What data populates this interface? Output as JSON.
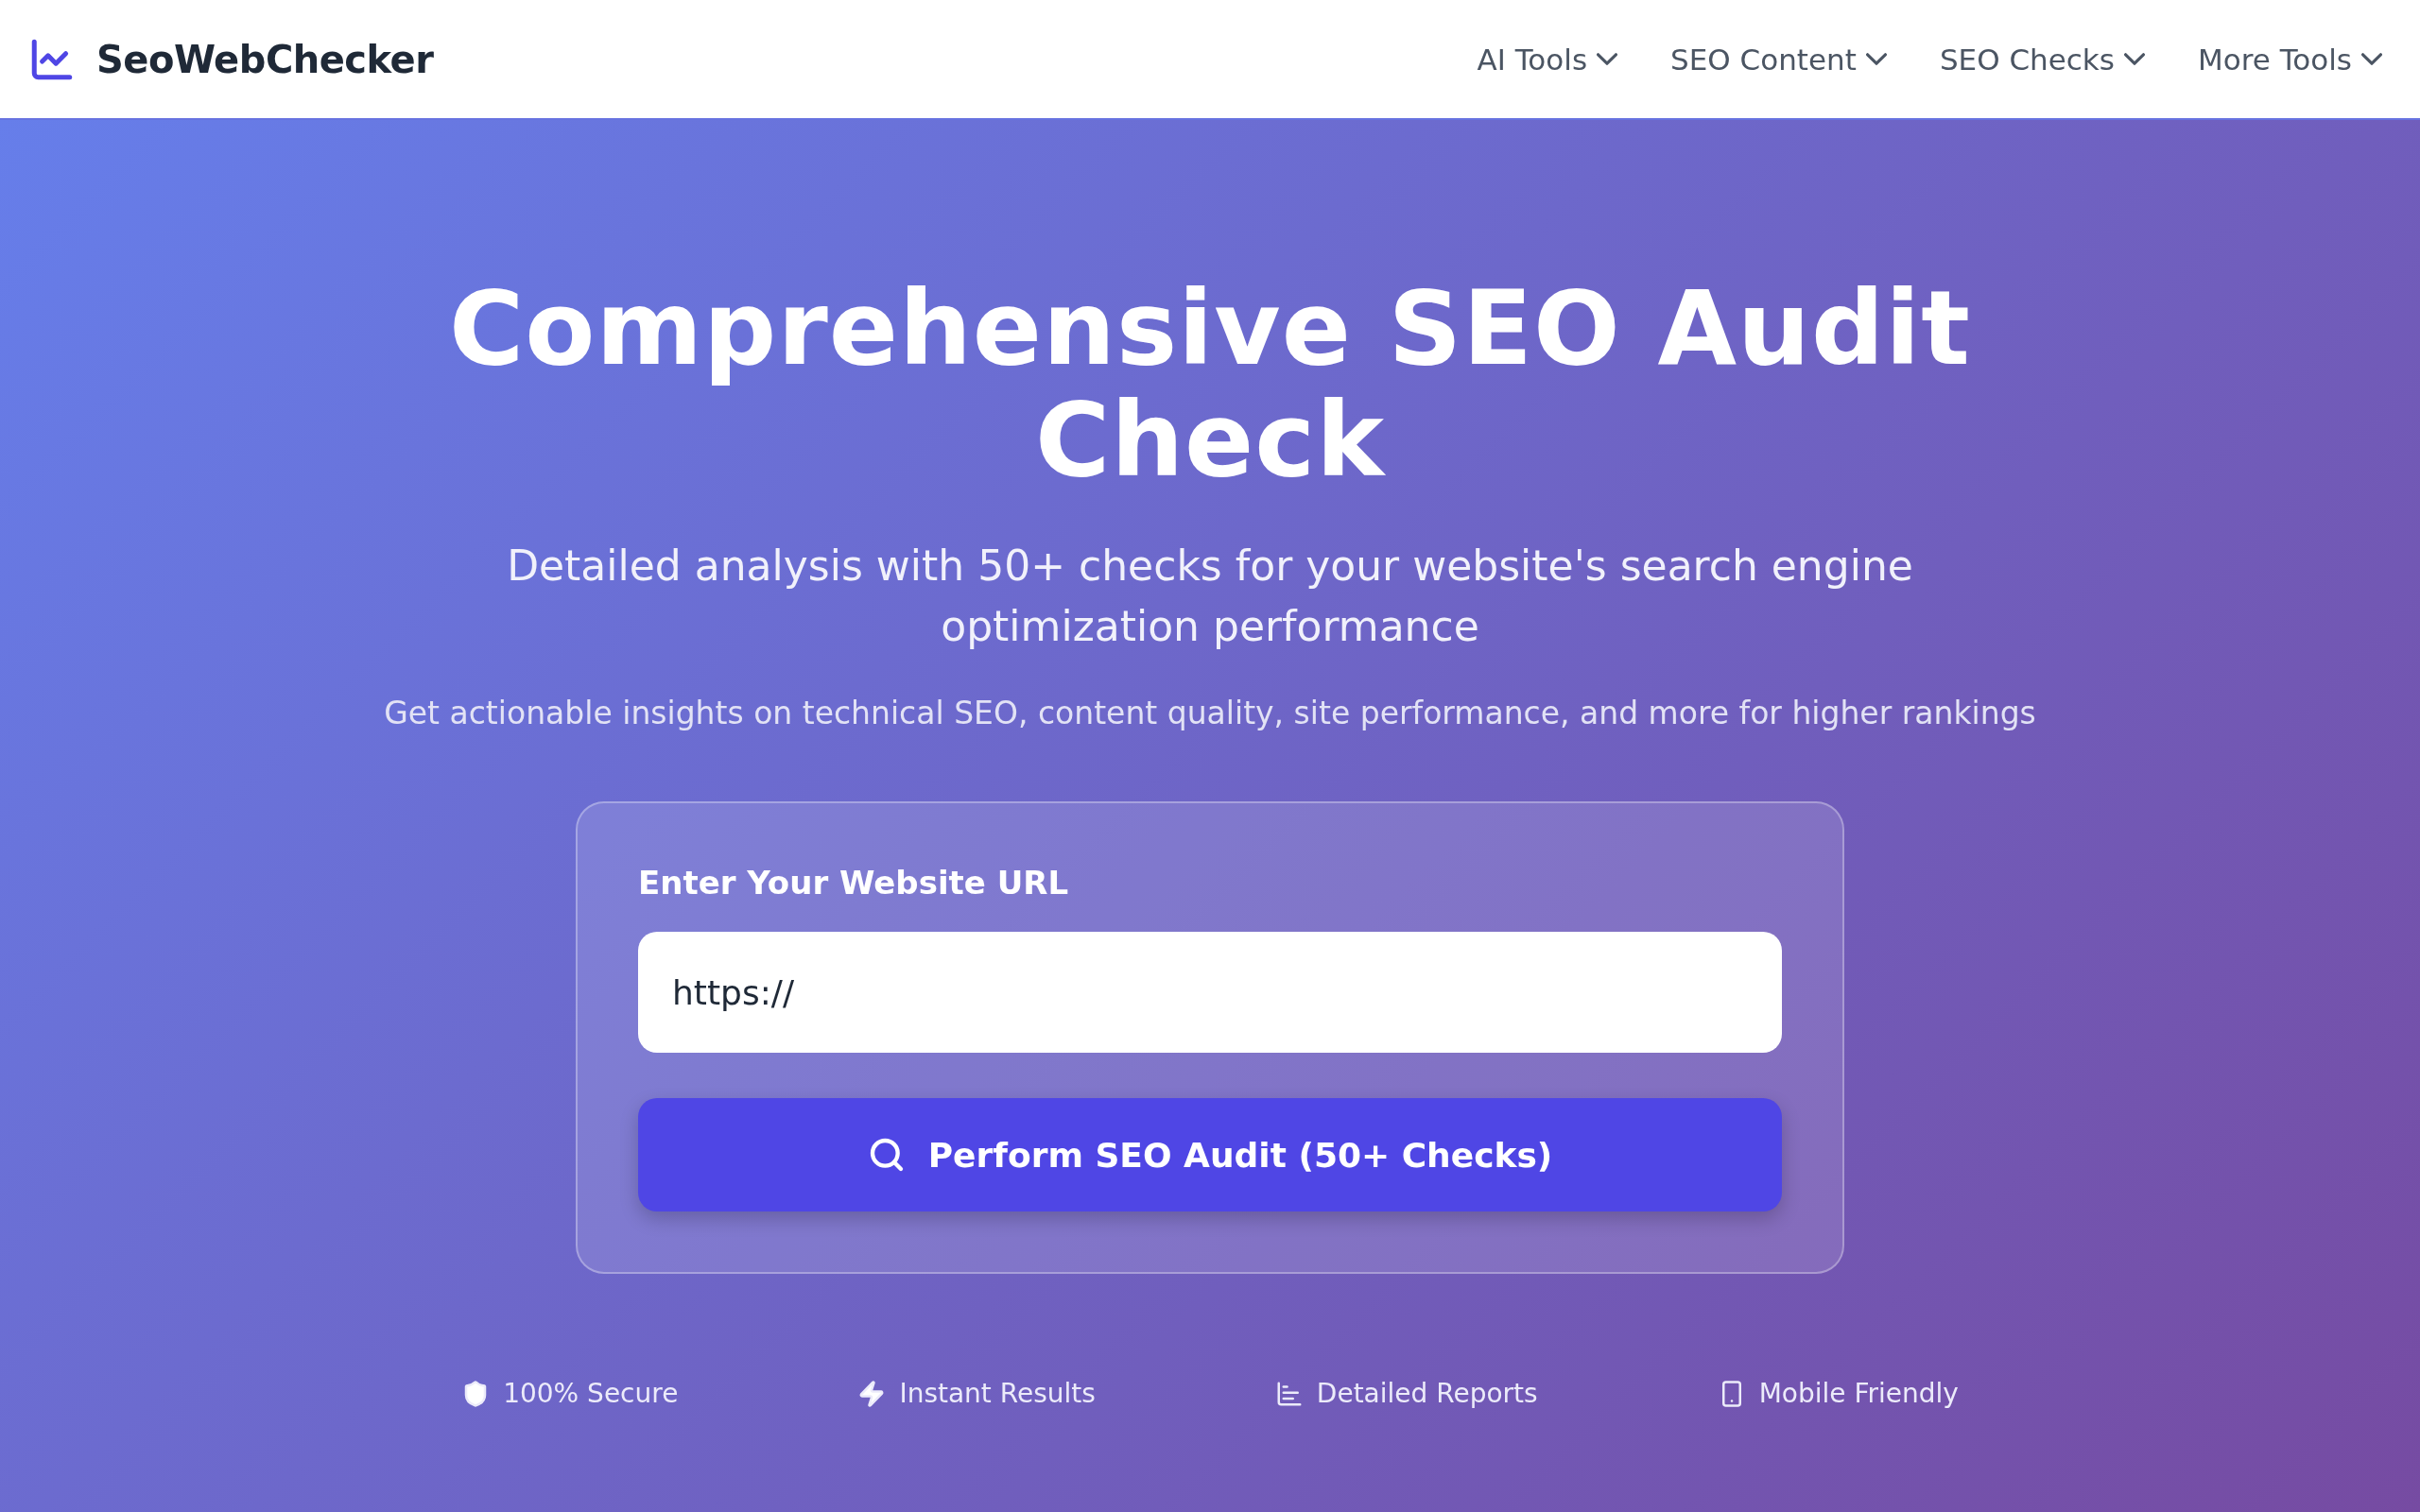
{
  "header": {
    "logo": "SeoWebChecker",
    "nav": [
      {
        "label": "AI Tools"
      },
      {
        "label": "SEO Content"
      },
      {
        "label": "SEO Checks"
      },
      {
        "label": "More Tools"
      }
    ]
  },
  "hero": {
    "title": "Comprehensive SEO Audit Check",
    "subtitle": "Detailed analysis with 50+ checks for your website's search engine optimization performance",
    "description": "Get actionable insights on technical SEO, content quality, site performance, and more for higher rankings"
  },
  "form": {
    "label": "Enter Your Website URL",
    "value": "https://",
    "button": "Perform SEO Audit (50+ Checks)"
  },
  "features": [
    {
      "kind": "shield",
      "label": "100% Secure"
    },
    {
      "kind": "bolt",
      "label": "Instant Results"
    },
    {
      "kind": "chart",
      "label": "Detailed Reports"
    },
    {
      "kind": "phone",
      "label": "Mobile Friendly"
    }
  ]
}
